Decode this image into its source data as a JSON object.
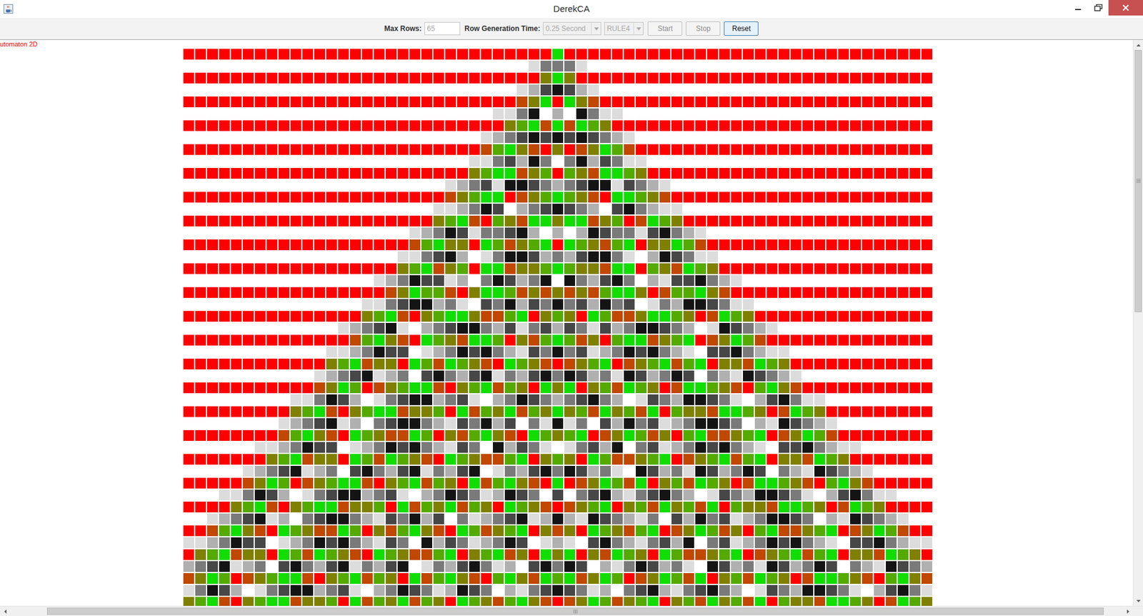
{
  "window": {
    "title": "DerekCA"
  },
  "toolbar": {
    "max_rows": {
      "label": "Max Rows:",
      "value": "65",
      "disabled": true
    },
    "generation_time": {
      "label": "Row Generation Time:",
      "value": "0.25 Second",
      "disabled": true
    },
    "rule": {
      "value": "RULE4",
      "disabled": true
    },
    "buttons": [
      {
        "label": "Start",
        "disabled": true,
        "focused": false
      },
      {
        "label": "Stop",
        "disabled": true,
        "focused": false
      },
      {
        "label": "Reset",
        "disabled": false,
        "focused": true
      }
    ]
  },
  "canvas": {
    "label": "utomaton 2D",
    "palette": {
      "R": "#ff0000",
      "N": "#11dd00",
      "Y": "#55aa00",
      "O": "#808000",
      "B": "#c04800",
      "W": "#ffffff",
      "L": "#dcdcdc",
      "M": "#b0b0b0",
      "G": "#7a7a7a",
      "D": "#474747",
      "K": "#141414"
    },
    "rows": [
      {
        "fill": "R",
        "cells": "N"
      },
      {
        "fill": "W",
        "cells": "LGGGL"
      },
      {
        "fill": "R",
        "cells": "ONO"
      },
      {
        "fill": "W",
        "cells": "LMDKDML"
      },
      {
        "fill": "R",
        "cells": "BONRNOB"
      },
      {
        "fill": "W",
        "cells": "LLGKWMWKGLL"
      },
      {
        "fill": "R",
        "cells": "OYNBNBNYO"
      },
      {
        "fill": "W",
        "cells": "LMGDKDKDKDGML"
      },
      {
        "fill": "R",
        "cells": "BYNOBRORBONYB"
      },
      {
        "fill": "W",
        "cells": "LLGDMKGWGKMDGLL"
      },
      {
        "fill": "R",
        "cells": "OYNNBOYRYOBNNYO"
      },
      {
        "fill": "W",
        "cells": "LMGDLKKDGMGDKKLDGML"
      },
      {
        "fill": "R",
        "cells": "BOYNNRBOYNYOBRNNYOB"
      },
      {
        "fill": "W",
        "cells": "LLMGKDWMGDKDGMWDKGMLL"
      },
      {
        "fill": "R",
        "cells": "OYNBRYOBNNONNBOYRBNYO"
      },
      {
        "fill": "W",
        "cells": "LMGKDLGGDKMWMWMKDGGLDKGML"
      },
      {
        "fill": "R",
        "cells": "BYNOORNYBOYNRNYOBYNROONYB"
      },
      {
        "fill": "W",
        "cells": "LLGDKMWLGKKDMGMDKKGLWMKDGLL"
      },
      {
        "fill": "R",
        "cells": "OYNBOYRNNBOOYNYOOBNNRYOBNYO"
      },
      {
        "fill": "W",
        "cells": "LMGKDDLMWGKDMGKWKGMDKGWMLDDKGML"
      },
      {
        "fill": "R",
        "cells": "BONYYBRONNYBOBOBOBYNNORBYYNOB"
      },
      {
        "fill": "W",
        "cells": "LLGDKKMGLWDGKMDGKGDMKGDWLGMKKDGLL"
      },
      {
        "fill": "R",
        "cells": "OYNBROYNNOBBYNROYORNYBBONNYORBNYO"
      },
      {
        "fill": "W",
        "cells": "LMGDKLWMGDKKGMDLGDMDGLDMGKKDGMWLKDGML"
      },
      {
        "fill": "R",
        "cells": "BYNOBRNYOBNNYROBYNYBORYNNBOYNRBONYB"
      },
      {
        "fill": "W",
        "cells": "LLMGKDDWLMGKDKGMLDGKGDLMGKDKGMLWDDKGMLL"
      },
      {
        "fill": "R",
        "cells": "OYNBOORNYBNYOBRNYOBRBOYNRBOYNBYNROOBNYO"
      },
      {
        "fill": "W",
        "cells": "LMGDKLMGWDKGMDKLGMDKGKDMGLKDMGKDWGMLKDGML"
      },
      {
        "fill": "R",
        "cells": "BONYRBOYNNBROYNBYORNONROYBNYORBNNYOBRYNOB"
      },
      {
        "fill": "W",
        "cells": "LLGKDMWLGDKKMGDLWMGKDGMGDKGMWLDGMKKDGLWMDKGLL"
      },
      {
        "fill": "R",
        "cells": "OYNBROYNNBOOYRNBYONBYONOYBNOYBNRYOOBNNYORBNYO"
      },
      {
        "fill": "W",
        "cells": "LMGDKLMWGDKKGMLDGKMDWGLKLGWDMKGDLMGKKDGWMLKDGML"
      },
      {
        "fill": "R",
        "cells": "BYNOBRNYOBBNYROBYNOBRNYOYNRBONYBORYNBBOYNRBONYB"
      },
      {
        "fill": "W",
        "cells": "LLMGKDDWLMGKDKGMLDGWKMDGLWLGDMKWGDLMGKDKGMLWDDKGMLL"
      },
      {
        "fill": "R",
        "cells": "OYNBOORNYBNYOBRNYOBBYNROYORNYBBOYNRBOYNBYNROOBNYO"
      },
      {
        "fill": "W",
        "cells": "LMGDKLMGWDKGMDKLGMDKWLGMDKGKDMGLWKDMGLKDMGKDWGMLKDGML"
      },
      {
        "fill": "R",
        "cells": "BONYRBOYNNBROYNBYORNBYNOBRNRBONYBNROYBNYORBNNYOBRYNOB"
      },
      {
        "fill": "W",
        "cells": "LLGKDMWLGDKKMGDLWMGKDGLMKDGWDWGDKMLGDKGMWLDGMKKDGLWMDKGLL"
      },
      {
        "fill": "R",
        "cells": "OYNBROYNNBOOYRNBYONBYORNYOBRBOYNROYBNOYBNRYOOBNNYORBNYO"
      },
      {
        "fill": "W",
        "cells": "LMGDKLMWGDKKGMLDGKMDWGLMGDKLMKMLKDGMLGWDMKGDLMGKKDGWMLKDGML"
      },
      {
        "fill": "R",
        "cells": "BYNOBRNYOBBNYROBYNOBRNYBOYNROBORNYOBYNRBONYBORYNBBOYNRBONYB"
      },
      {
        "fill": "W",
        "cells": "LLMGKDDWLMGKDKGMLDGWKMDGLMGKDWLMLWDKGMLGDMKWGDLMGKDKGMLWDDKGMLL"
      },
      {
        "fill": "R",
        "cells": "OYNBOORNYBNYOBRNYOBBYNROYNBORNONROBNYORNYBBOYNRBOYNBYNROOBNYO"
      },
      {
        "fill": "W",
        "cells": "MGDKLMGWDKGMDKLGMDKWLGMDKGLMWDKGKDWMLGKDMGLWKDMGLKDMGKDWGMLKDGM"
      },
      {
        "fill": "R",
        "cells": "BONYRBOYNNBROYNBYORNBYNOBRYNOBNYNBONYRBONYBNROYBNYORBNNYOBRYNOB"
      },
      {
        "fill": "W",
        "cells": "LGKDMWLGDKKMGDLWMGKDGLMKDGWMLGDKDGLMWGDKMLGDKGMWLDGMKKDGLWMDKGL"
      },
      {
        "fill": "R",
        "cells": "OYNBROYNNBOOYRNBYONBYORNYOBYNOBRBONYBOYNROYBNOYBNRYOOBNNYORBNYO"
      }
    ]
  },
  "scrollbars": {
    "vertical": {
      "start": 0,
      "size": 0.48
    },
    "horizontal": {
      "start": 0.033,
      "size": 0.95
    }
  }
}
